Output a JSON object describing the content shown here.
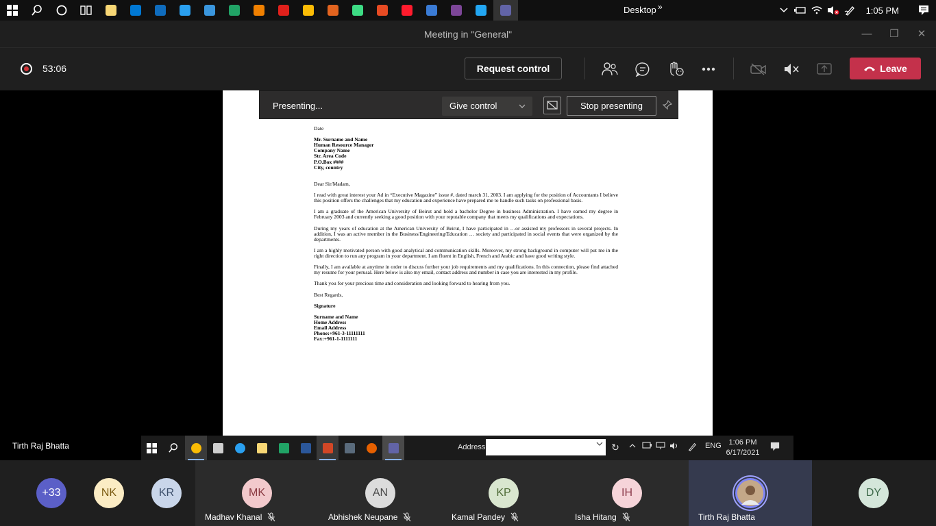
{
  "host_taskbar": {
    "desktop_label": "Desktop",
    "overflow_label": "»",
    "time": "1:05 PM",
    "apps": [
      {
        "name": "file-explorer-icon",
        "color": "#f8d775"
      },
      {
        "name": "store-icon",
        "color": "#0078d4"
      },
      {
        "name": "mail-icon",
        "color": "#0f6cbd"
      },
      {
        "name": "edge-icon",
        "color": "#2aa0f0"
      },
      {
        "name": "remote-desktop-icon",
        "color": "#3a96dd"
      },
      {
        "name": "excel-icon",
        "color": "#21a366"
      },
      {
        "name": "vlc-icon",
        "color": "#f08000"
      },
      {
        "name": "acrobat-icon",
        "color": "#e0201b"
      },
      {
        "name": "chrome-icon",
        "color": "#fbbc05"
      },
      {
        "name": "recorder-icon",
        "color": "#e3641f"
      },
      {
        "name": "android-studio-icon",
        "color": "#3ddc84"
      },
      {
        "name": "office-icon",
        "color": "#e74b23"
      },
      {
        "name": "opera-icon",
        "color": "#ff1b2d"
      },
      {
        "name": "app-icon",
        "color": "#3a7bd5"
      },
      {
        "name": "tor-browser-icon",
        "color": "#7d4698"
      },
      {
        "name": "vscode-icon",
        "color": "#22a6f2"
      },
      {
        "name": "teams-icon",
        "color": "#6264a7"
      }
    ]
  },
  "window": {
    "title": "Meeting in \"General\"",
    "minimize": "—",
    "maximize": "❐",
    "close": "✕"
  },
  "controls": {
    "timer": "53:06",
    "request_control": "Request control",
    "leave": "Leave"
  },
  "share_bar": {
    "status": "Presenting...",
    "give_control": "Give control",
    "stop_presenting": "Stop presenting"
  },
  "letter": {
    "date": "Date",
    "recipient": [
      "Mr. Surname and Name",
      "Human Resource Manager",
      "Company Name",
      "Str. Area Code",
      "P.O.Box ####",
      "City, country"
    ],
    "salutation": "Dear Sir/Madam,",
    "paragraphs": [
      "I read with great interest your Ad in “Executive Magazine” issue #, dated march 31, 2003. I am applying for the position of Accountants I believe this position offers the challenges that my education and experience have prepared me to handle such tasks on professional basis.",
      "I am a graduate of the American University of Beirut and hold a bachelor Degree in business Administration. I have earned my degree in February 2003 and currently seeking a good position with your reputable company that meets my qualifications and expectations.",
      "During my years of education at the American University of Beirut, I have participated in …or assisted my professors in several projects. In addition, I was an active member in the Business/Engineering/Education … society and participated in social events that were organized by the departments.",
      "I am a highly motivated person with good analytical and communication skills. Moreover, my strong background in computer will put me in the right direction to run any program in your department. I am fluent in English, French and Arabic and have good writing style.",
      "Finally, I am available at anytime in order to discuss further your job requirements and my qualifications. In this connection, please find attached my resume for your perusal. Here below is also my email, contact address and number in case you are interested in my profile.",
      "Thank you for your precious time and consideration and looking forward to hearing from you."
    ],
    "closing": "Best Regards,",
    "signature": "Signature",
    "sender": [
      "Surname and Name",
      "Home Address",
      "Email Address",
      "Phone:+961-3-11111111",
      "Fax:+961-1-1111111"
    ]
  },
  "presenter_label": "Tirth Raj Bhatta",
  "remote_taskbar": {
    "address_label": "Address",
    "address_value": "",
    "lang": "ENG",
    "time": "1:06 PM",
    "date": "6/17/2021"
  },
  "participants": {
    "overflow": "+33",
    "avatars_small": [
      {
        "initials": "NK",
        "bg": "#fbecc4",
        "fg": "#7a5a10"
      },
      {
        "initials": "KR",
        "bg": "#c9d6ea",
        "fg": "#3b4e6a"
      }
    ],
    "tiles": [
      {
        "initials": "MK",
        "name": "Madhav Khanal",
        "bg": "#f2c9cc",
        "fg": "#8a3a42"
      },
      {
        "initials": "AN",
        "name": "Abhishek Neupane",
        "bg": "#dcdcdc",
        "fg": "#4a4a4a"
      },
      {
        "initials": "KP",
        "name": "Kamal Pandey",
        "bg": "#d9e6cf",
        "fg": "#4d6a35"
      },
      {
        "initials": "IH",
        "name": "Isha Hitang",
        "bg": "#f6d4d9",
        "fg": "#8a3a4a"
      },
      {
        "initials": "",
        "name": "Tirth Raj Bhatta",
        "bg": "#c4a888",
        "fg": "#3b2a1a"
      }
    ],
    "last": {
      "initials": "DY",
      "bg": "#d4e6da",
      "fg": "#3d6a4a"
    }
  }
}
